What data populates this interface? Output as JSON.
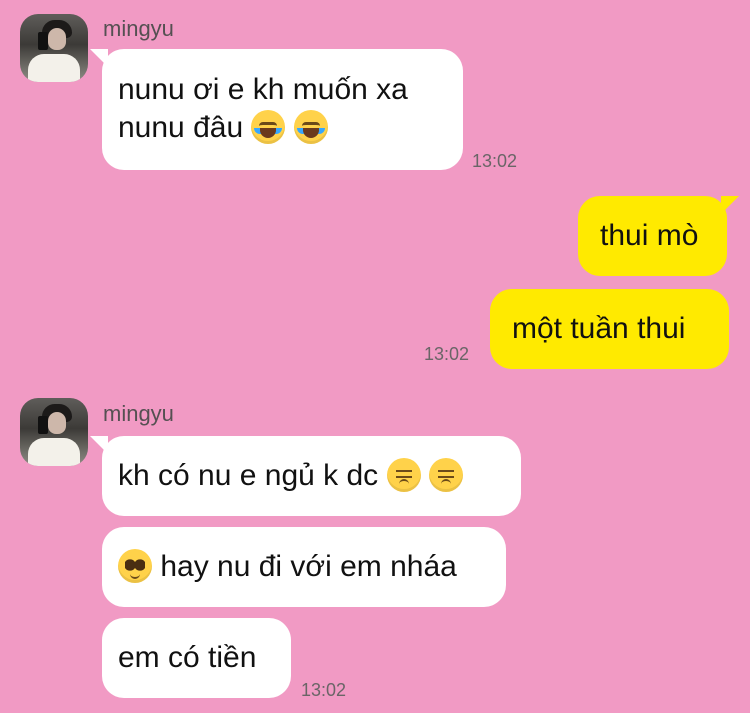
{
  "contact": {
    "name": "mingyu"
  },
  "messages": [
    {
      "id": "m1",
      "sender": "mingyu",
      "direction": "incoming",
      "text_line1": "nunu ơi e kh muốn xa",
      "text_line2": "nunu đâu",
      "emojis": [
        "loudly-crying-face",
        "loudly-crying-face"
      ],
      "time": "13:02"
    },
    {
      "id": "m2",
      "direction": "outgoing",
      "text": "thui mò"
    },
    {
      "id": "m3",
      "direction": "outgoing",
      "text": "một tuần thui",
      "time": "13:02"
    },
    {
      "id": "m4",
      "sender": "mingyu",
      "direction": "incoming",
      "text": "kh có nu e ngủ k dc",
      "emojis": [
        "pensive-face",
        "pensive-face"
      ]
    },
    {
      "id": "m5",
      "direction": "incoming",
      "emoji_prefix": "pleading-face",
      "text": "hay nu đi với em nháa"
    },
    {
      "id": "m6",
      "direction": "incoming",
      "text": "em có tiền",
      "time": "13:02"
    }
  ],
  "colors": {
    "background": "#f19ac4",
    "incoming_bubble": "#ffffff",
    "outgoing_bubble": "#ffea00",
    "time_text": "#6a6567"
  }
}
